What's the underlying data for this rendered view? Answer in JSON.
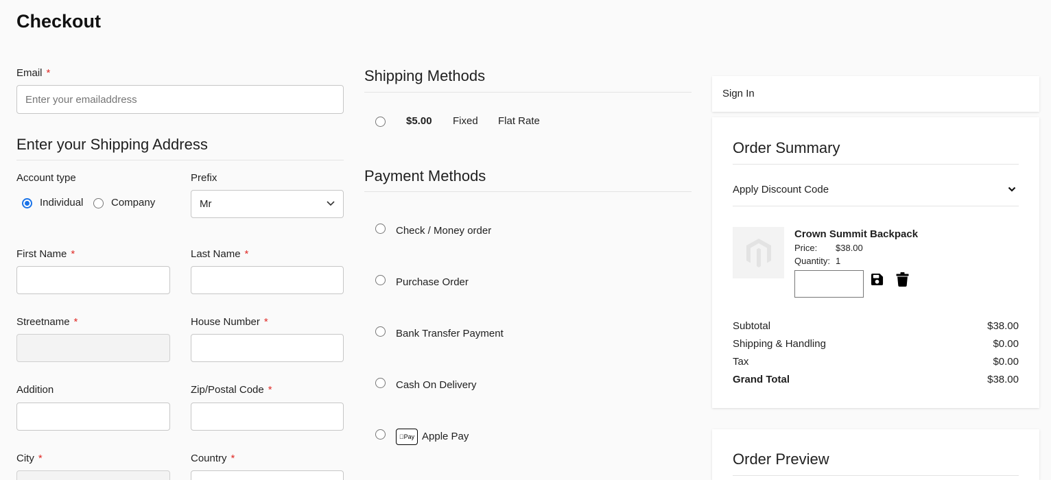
{
  "page": {
    "title": "Checkout"
  },
  "email": {
    "label": "Email",
    "required": "*",
    "placeholder": "Enter your emailaddress"
  },
  "shipping_address": {
    "heading": "Enter your Shipping Address",
    "account_type": {
      "label": "Account type",
      "options": [
        "Individual",
        "Company"
      ],
      "selected": "Individual"
    },
    "prefix": {
      "label": "Prefix",
      "value": "Mr"
    },
    "first_name": {
      "label": "First Name",
      "required": "*",
      "value": ""
    },
    "last_name": {
      "label": "Last Name",
      "required": "*",
      "value": ""
    },
    "streetname": {
      "label": "Streetname",
      "required": "*",
      "value": ""
    },
    "house_number": {
      "label": "House Number",
      "required": "*",
      "value": ""
    },
    "addition": {
      "label": "Addition",
      "value": ""
    },
    "zip": {
      "label": "Zip/Postal Code",
      "required": "*",
      "value": ""
    },
    "city": {
      "label": "City",
      "required": "*",
      "value": ""
    },
    "country": {
      "label": "Country",
      "required": "*",
      "value": ""
    }
  },
  "shipping_methods": {
    "heading": "Shipping Methods",
    "options": [
      {
        "price": "$5.00",
        "type": "Fixed",
        "name": "Flat Rate"
      }
    ]
  },
  "payment_methods": {
    "heading": "Payment Methods",
    "options": [
      {
        "label": "Check / Money order"
      },
      {
        "label": "Purchase Order"
      },
      {
        "label": "Bank Transfer Payment"
      },
      {
        "label": "Cash On Delivery"
      },
      {
        "label": "Apple Pay",
        "badge": "Pay"
      }
    ]
  },
  "sign_in": {
    "label": "Sign In"
  },
  "order_summary": {
    "heading": "Order Summary",
    "discount": {
      "label": "Apply Discount Code"
    },
    "item": {
      "name": "Crown Summit Backpack",
      "price_label": "Price:",
      "price": "$38.00",
      "qty_label": "Quantity:",
      "qty": "1"
    },
    "totals": [
      {
        "label": "Subtotal",
        "value": "$38.00"
      },
      {
        "label": "Shipping & Handling",
        "value": "$0.00"
      },
      {
        "label": "Tax",
        "value": "$0.00"
      },
      {
        "label": "Grand Total",
        "value": "$38.00"
      }
    ]
  },
  "order_preview": {
    "heading": "Order Preview"
  },
  "colors": {
    "accent": "#1a73e8",
    "required": "#e02b27"
  }
}
